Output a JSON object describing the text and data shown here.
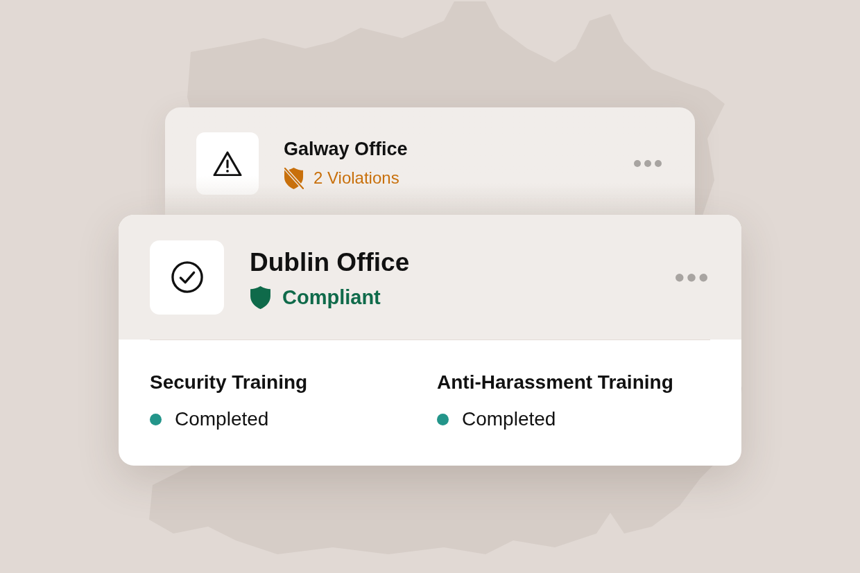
{
  "offices": [
    {
      "name": "Galway Office",
      "status": {
        "kind": "violations",
        "label": "2 Violations"
      }
    },
    {
      "name": "Dublin Office",
      "status": {
        "kind": "compliant",
        "label": "Compliant"
      },
      "trainings": [
        {
          "title": "Security Training",
          "status": "Completed",
          "color": "#23958a"
        },
        {
          "title": "Anti-Harassment Training",
          "status": "Completed",
          "color": "#23958a"
        }
      ]
    }
  ]
}
